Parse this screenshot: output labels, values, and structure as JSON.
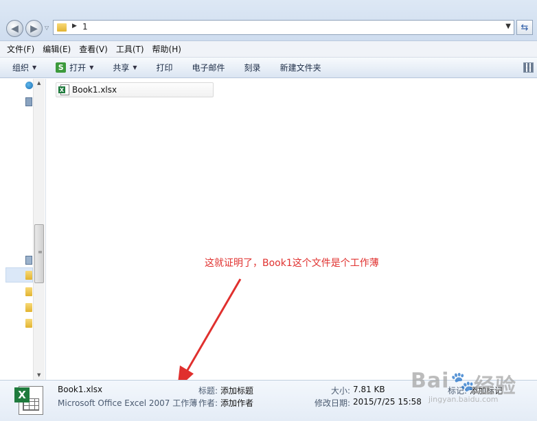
{
  "address": {
    "path": "1"
  },
  "menu": [
    "文件(F)",
    "编辑(E)",
    "查看(V)",
    "工具(T)",
    "帮助(H)"
  ],
  "toolbar": {
    "organize": "组织",
    "open": "打开",
    "share": "共享",
    "print": "打印",
    "email": "电子邮件",
    "burn": "刻录",
    "new_folder": "新建文件夹"
  },
  "files": [
    {
      "name": "Book1.xlsx"
    }
  ],
  "annotation": "这就证明了，Book1这个文件是个工作薄",
  "details": {
    "name": "Book1.xlsx",
    "type": "Microsoft Office Excel 2007 工作薄",
    "title_label": "标题:",
    "title_value": "添加标题",
    "author_label": "作者:",
    "author_value": "添加作者",
    "size_label": "大小:",
    "size_value": "7.81 KB",
    "modified_label": "修改日期:",
    "modified_value": "2015/7/25 15:58",
    "tags_label": "标记:",
    "tags_value": "添加标记"
  },
  "watermark": {
    "brand": "Bai",
    "brand2": "经验",
    "url": "jingyan.baidu.com"
  },
  "colors": {
    "accent": "#e0302e",
    "excel_green": "#1f7b3d"
  }
}
